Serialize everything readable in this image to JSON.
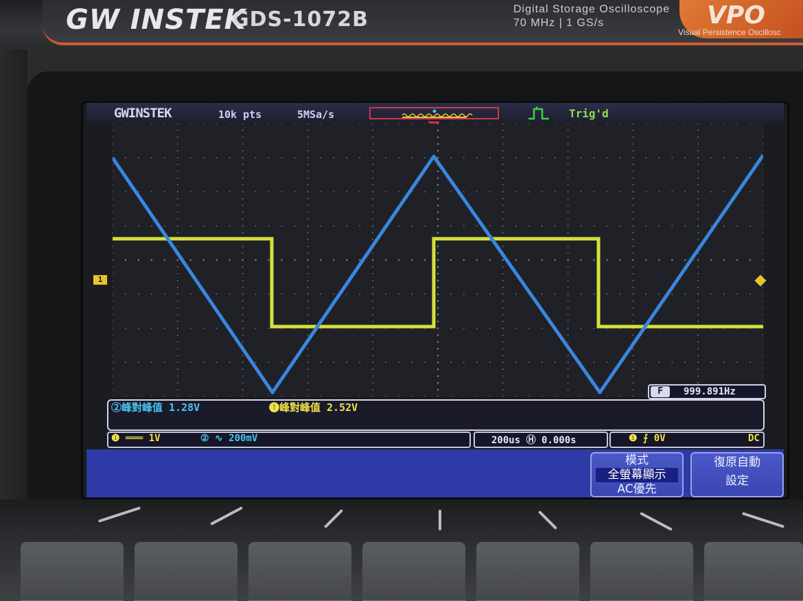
{
  "bezel": {
    "brand": "GW INSTEK",
    "model": "GDS-1072B",
    "description_line1": "Digital Storage Oscilloscope",
    "description_line2": "70 MHz | 1 GS/s",
    "badge": "VPO",
    "badge_subtitle": "Visual Persistence Oscillosc"
  },
  "status": {
    "logo": "GWINSTEK",
    "record_length": "10k pts",
    "sample_rate": "5MSa/s",
    "trigger_status": "Trig'd"
  },
  "markers": {
    "ch1_ground": "1"
  },
  "measurement": {
    "frequency_label": "F",
    "frequency_value": "999.891Hz",
    "ch2_peak_to_peak": "②峰對峰值 1.28V",
    "ch1_peak_to_peak": "❶峰對峰值 2.52V"
  },
  "info": {
    "ch1": "❶ ═══  1V",
    "ch2": "② ∿ 200mV",
    "timebase": "200us Ⓗ 0.000s",
    "trigger": "❶  ⨍   0V",
    "coupling": "DC"
  },
  "softkeys": {
    "mode_title": "模式",
    "mode_option1": "全螢幕顯示",
    "mode_option2": "AC優先",
    "autoset_line1": "復原自動",
    "autoset_line2": "設定"
  },
  "colors": {
    "ch1": "#e7e83a",
    "ch2": "#3f8fe8",
    "screen_bg": "#202126",
    "menu_bg": "#2e3aa6"
  },
  "waveforms": {
    "ch2_shape": "triangle",
    "ch1_shape": "square",
    "ch2_vpp_volts": 1.28,
    "ch1_vpp_volts": 2.52,
    "frequency_hz": 999.891
  }
}
